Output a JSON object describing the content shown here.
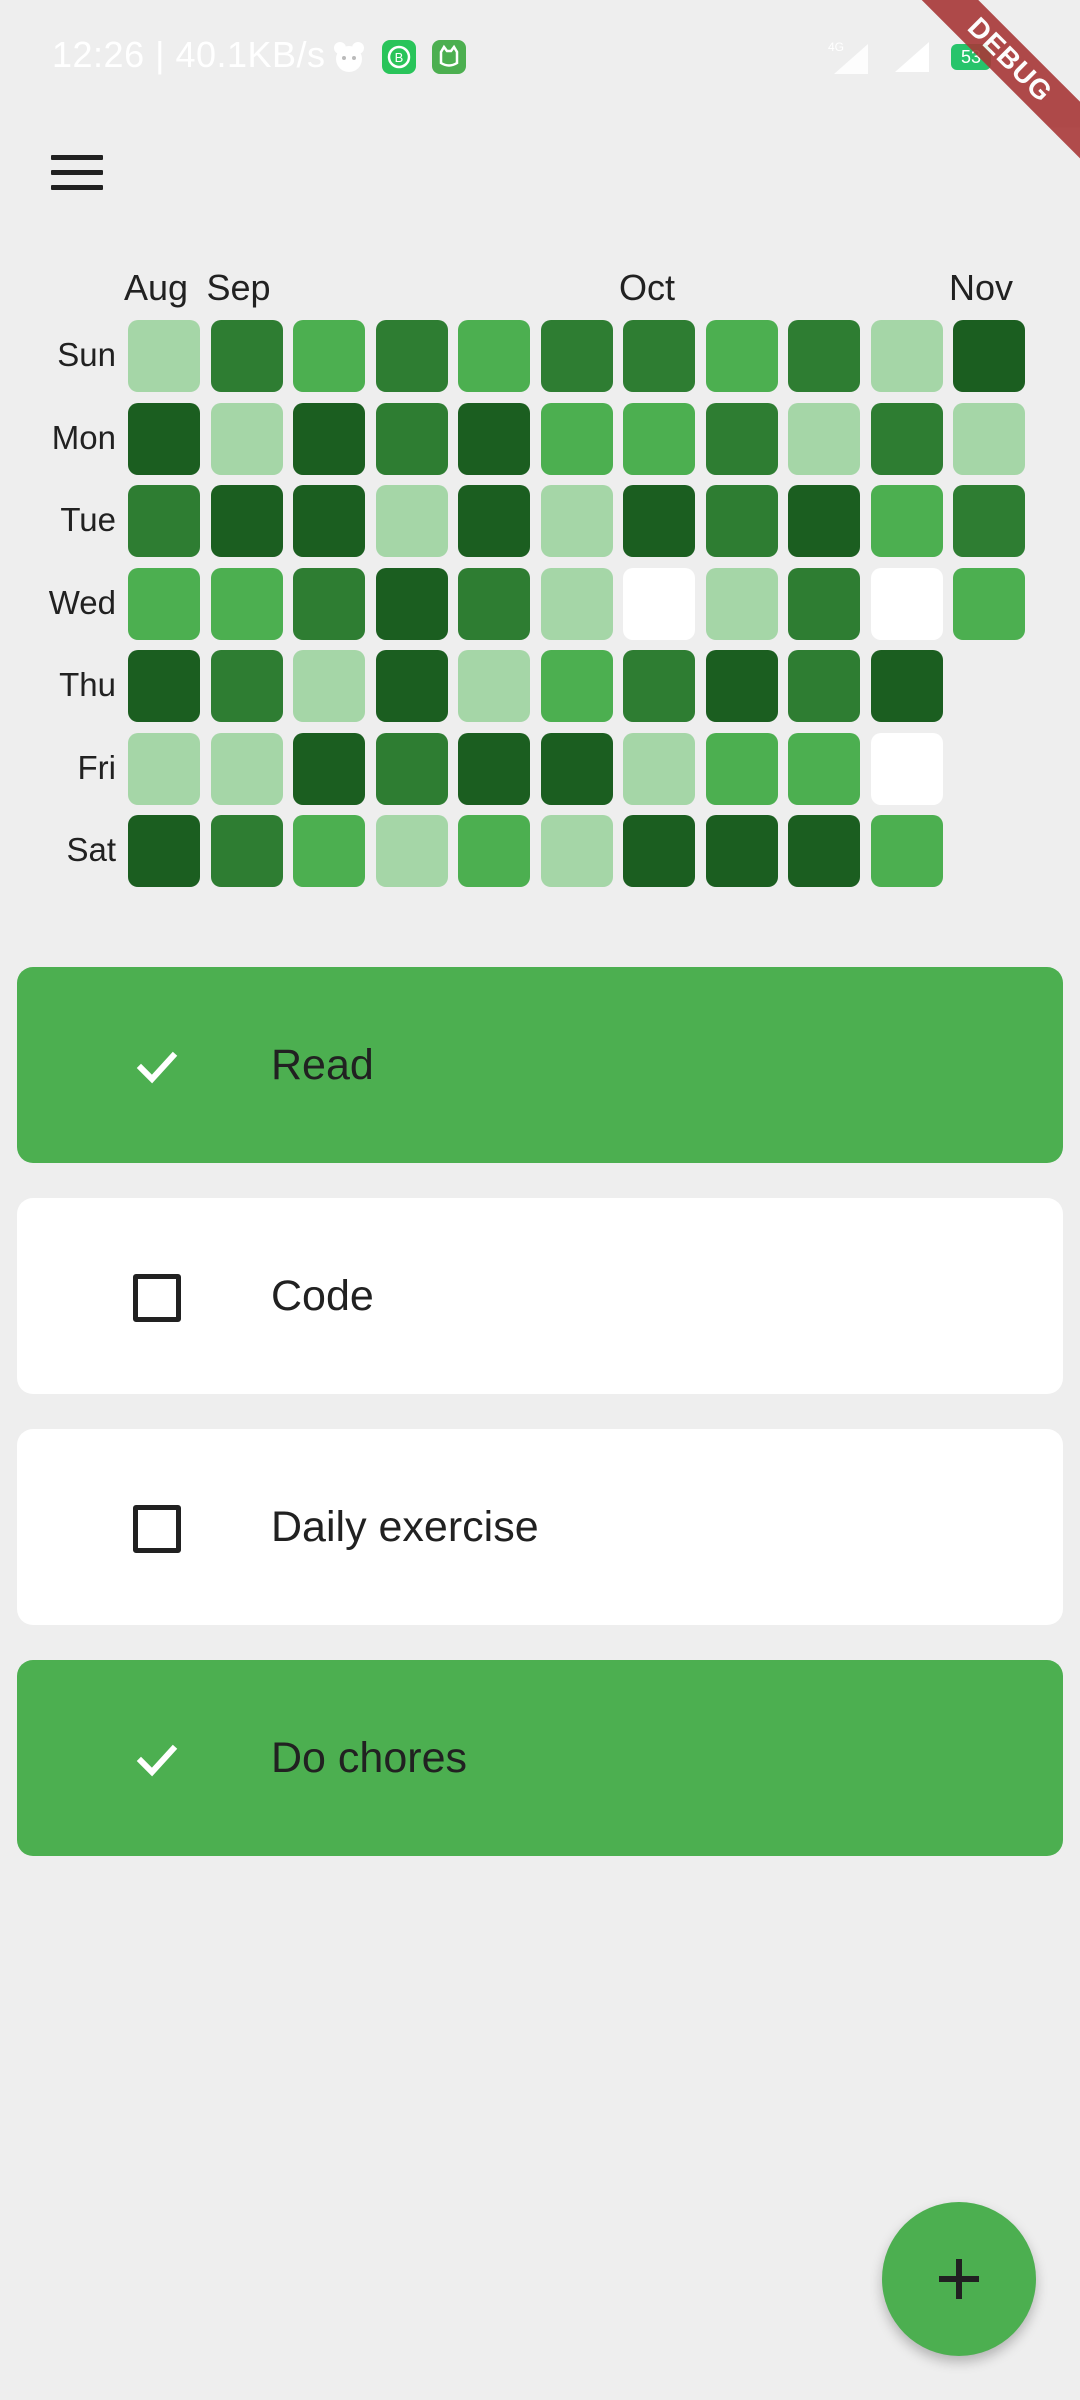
{
  "status_bar": {
    "time_speed": "12:26 | 40.1KB/s",
    "network": "4G",
    "battery": "53",
    "debug": "DEBUG"
  },
  "colors": {
    "background": "#eeeeee",
    "accent": "#4caf50",
    "level_0": "#ffffff",
    "level_1": "#a5d6a7",
    "level_2": "#4caf50",
    "level_3": "#2e7d32",
    "level_4": "#1b5e20"
  },
  "icons": {
    "menu": "hamburger-menu-icon",
    "check": "check-icon",
    "checkbox": "checkbox-empty-icon",
    "add": "plus-icon"
  },
  "heatmap": {
    "months": [
      {
        "label": "Aug",
        "column": 0
      },
      {
        "label": "Sep",
        "column": 1
      },
      {
        "label": "Oct",
        "column": 6
      },
      {
        "label": "Nov",
        "column": 10
      }
    ],
    "days": [
      "Sun",
      "Mon",
      "Tue",
      "Wed",
      "Thu",
      "Fri",
      "Sat"
    ],
    "levels": [
      [
        1,
        4,
        3,
        2,
        4,
        1,
        4
      ],
      [
        3,
        1,
        4,
        2,
        3,
        1,
        3
      ],
      [
        2,
        4,
        4,
        3,
        1,
        4,
        2
      ],
      [
        3,
        3,
        1,
        4,
        4,
        3,
        1
      ],
      [
        2,
        4,
        4,
        3,
        1,
        4,
        2
      ],
      [
        3,
        2,
        1,
        1,
        2,
        4,
        1
      ],
      [
        3,
        2,
        4,
        0,
        3,
        1,
        4
      ],
      [
        2,
        3,
        3,
        1,
        4,
        2,
        4
      ],
      [
        3,
        1,
        4,
        3,
        3,
        2,
        4
      ],
      [
        1,
        3,
        2,
        0,
        4,
        0,
        2
      ],
      [
        4,
        1,
        3,
        2,
        null,
        null,
        null
      ]
    ]
  },
  "habits": [
    {
      "label": "Read",
      "done": true
    },
    {
      "label": "Code",
      "done": false
    },
    {
      "label": "Daily exercise",
      "done": false
    },
    {
      "label": "Do chores",
      "done": true
    }
  ],
  "fab_symbol": "+"
}
